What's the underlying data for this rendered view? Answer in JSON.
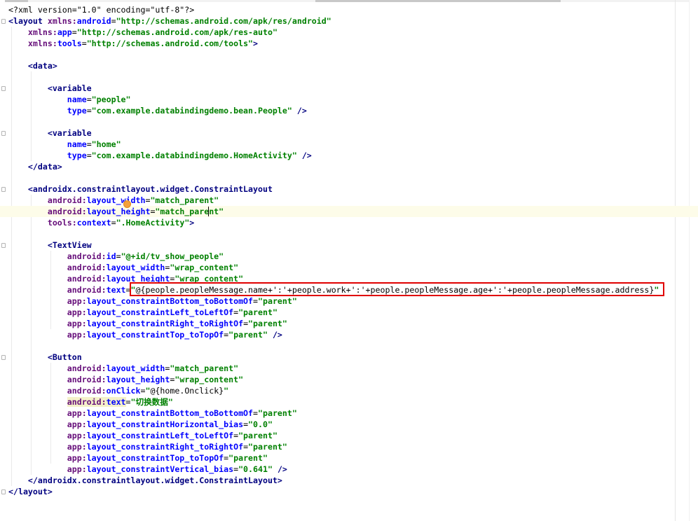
{
  "editor": {
    "lines": [
      {
        "t": "&lt;?xml version=\"1.0\" encoding=\"utf-8\"?&gt;",
        "html": true
      },
      {
        "t": "<span class='tag'>&lt;layout </span><span class='ns'>xmlns:</span><span class='attr'>android</span><span class='plain'>=</span><span class='val'>\"http://schemas.android.com/apk/res/android\"</span>",
        "html": true
      },
      {
        "t": "    <span class='ns'>xmlns:</span><span class='attr'>app</span><span class='plain'>=</span><span class='val'>\"http://schemas.android.com/apk/res-auto\"</span>",
        "html": true
      },
      {
        "t": "    <span class='ns'>xmlns:</span><span class='attr'>tools</span><span class='plain'>=</span><span class='val'>\"http://schemas.android.com/tools\"</span><span class='tag'>&gt;</span>",
        "html": true
      },
      {
        "t": "",
        "html": true
      },
      {
        "t": "    <span class='tag'>&lt;data&gt;</span>",
        "html": true
      },
      {
        "t": "",
        "html": true
      },
      {
        "t": "        <span class='tag'>&lt;variable</span>",
        "html": true
      },
      {
        "t": "            <span class='attr'>name</span><span class='plain'>=</span><span class='val'>\"people\"</span>",
        "html": true
      },
      {
        "t": "            <span class='attr'>type</span><span class='plain'>=</span><span class='val'>\"com.example.databindingdemo.bean.People\"</span> <span class='tag'>/&gt;</span>",
        "html": true
      },
      {
        "t": "",
        "html": true
      },
      {
        "t": "        <span class='tag'>&lt;variable</span>",
        "html": true
      },
      {
        "t": "            <span class='attr'>name</span><span class='plain'>=</span><span class='val'>\"home\"</span>",
        "html": true
      },
      {
        "t": "            <span class='attr'>type</span><span class='plain'>=</span><span class='val'>\"com.example.databindingdemo.HomeActivity\"</span> <span class='tag'>/&gt;</span>",
        "html": true
      },
      {
        "t": "    <span class='tag'>&lt;/data&gt;</span>",
        "html": true
      },
      {
        "t": "",
        "html": true
      },
      {
        "t": "    <span class='tag'>&lt;androidx.constraintlayout.widget.ConstraintLayout</span>",
        "html": true
      },
      {
        "t": "        <span class='ns'>android:</span><span class='attr'>layout_width</span><span class='plain'>=</span><span class='val'>\"match_parent\"</span>",
        "html": true
      },
      {
        "t": "        <span class='ns'>android:</span><span class='attr'>layout_height</span><span class='plain'>=</span><span class='val'>\"match_parent\"</span>",
        "html": true
      },
      {
        "t": "        <span class='ns'>tools:</span><span class='attr'>context</span><span class='plain'>=</span><span class='val'>\".HomeActivity\"</span><span class='tag'>&gt;</span>",
        "html": true
      },
      {
        "t": "",
        "html": true
      },
      {
        "t": "        <span class='tag'>&lt;TextView</span>",
        "html": true
      },
      {
        "t": "            <span class='ns'>android:</span><span class='attr'>id</span><span class='plain'>=</span><span class='val'>\"@+id/tv_show_people\"</span>",
        "html": true
      },
      {
        "t": "            <span class='ns'>android:</span><span class='attr'>layout_width</span><span class='plain'>=</span><span class='val'>\"wrap_content\"</span>",
        "html": true
      },
      {
        "t": "            <span class='ns'>android:</span><span class='attr'>layout_height</span><span class='plain'>=</span><span class='val'>\"wrap_content\"</span>",
        "html": true
      },
      {
        "t": "            <span class='ns'>android:</span><span class='attr'>text</span><span class='plain'>=</span><span class='val'>\"</span><span class='plain'>@{people.peopleMessage.name+':'+people.work+':'+people.peopleMessage.age+':'+people.peopleMessage.address}</span><span class='val'>\"</span>",
        "html": true
      },
      {
        "t": "            <span class='ns'>app:</span><span class='attr'>layout_constraintBottom_toBottomOf</span><span class='plain'>=</span><span class='val'>\"parent\"</span>",
        "html": true
      },
      {
        "t": "            <span class='ns'>app:</span><span class='attr'>layout_constraintLeft_toLeftOf</span><span class='plain'>=</span><span class='val'>\"parent\"</span>",
        "html": true
      },
      {
        "t": "            <span class='ns'>app:</span><span class='attr'>layout_constraintRight_toRightOf</span><span class='plain'>=</span><span class='val'>\"parent\"</span>",
        "html": true
      },
      {
        "t": "            <span class='ns'>app:</span><span class='attr'>layout_constraintTop_toTopOf</span><span class='plain'>=</span><span class='val'>\"parent\"</span> <span class='tag'>/&gt;</span>",
        "html": true
      },
      {
        "t": "",
        "html": true
      },
      {
        "t": "        <span class='tag'>&lt;Button</span>",
        "html": true
      },
      {
        "t": "            <span class='ns'>android:</span><span class='attr'>layout_width</span><span class='plain'>=</span><span class='val'>\"match_parent\"</span>",
        "html": true
      },
      {
        "t": "            <span class='ns'>android:</span><span class='attr'>layout_height</span><span class='plain'>=</span><span class='val'>\"wrap_content\"</span>",
        "html": true
      },
      {
        "t": "            <span class='ns'>android:</span><span class='attr'>onClick</span><span class='plain'>=</span><span class='val'>\"</span><span class='plain'>@{home.Onclick}</span><span class='val'>\"</span>",
        "html": true
      },
      {
        "t": "            <span class='hl-attr'><span class='ns'>android:</span><span class='attr'>text</span></span><span class='plain'>=</span><span class='val'>\"切换数据\"</span>",
        "html": true
      },
      {
        "t": "            <span class='ns'>app:</span><span class='attr'>layout_constraintBottom_toBottomOf</span><span class='plain'>=</span><span class='val'>\"parent\"</span>",
        "html": true
      },
      {
        "t": "            <span class='ns'>app:</span><span class='attr'>layout_constraintHorizontal_bias</span><span class='plain'>=</span><span class='val'>\"0.0\"</span>",
        "html": true
      },
      {
        "t": "            <span class='ns'>app:</span><span class='attr'>layout_constraintLeft_toLeftOf</span><span class='plain'>=</span><span class='val'>\"parent\"</span>",
        "html": true
      },
      {
        "t": "            <span class='ns'>app:</span><span class='attr'>layout_constraintRight_toRightOf</span><span class='plain'>=</span><span class='val'>\"parent\"</span>",
        "html": true
      },
      {
        "t": "            <span class='ns'>app:</span><span class='attr'>layout_constraintTop_toTopOf</span><span class='plain'>=</span><span class='val'>\"parent\"</span>",
        "html": true
      },
      {
        "t": "            <span class='ns'>app:</span><span class='attr'>layout_constraintVertical_bias</span><span class='plain'>=</span><span class='val'>\"0.641\"</span> <span class='tag'>/&gt;</span>",
        "html": true
      },
      {
        "t": "    <span class='tag'>&lt;/androidx.constraintlayout.widget.ConstraintLayout&gt;</span>",
        "html": true
      },
      {
        "t": "<span class='tag'>&lt;/layout&gt;</span>",
        "html": true
      }
    ],
    "caret_line_index": 18,
    "highlighted_expression": "@{people.peopleMessage.name+':'+people.work+':'+people.peopleMessage.age+':'+people.peopleMessage.address}"
  },
  "colors": {
    "tag": "#000080",
    "namespace": "#660e7a",
    "attribute": "#0000ff",
    "value": "#008000",
    "caret_line_bg": "#fdfce9",
    "annotation_box": "#e00000",
    "intention_bulb": "#f3a13b"
  },
  "icons": [
    "fold-marker-icon",
    "intention-bulb-icon"
  ]
}
